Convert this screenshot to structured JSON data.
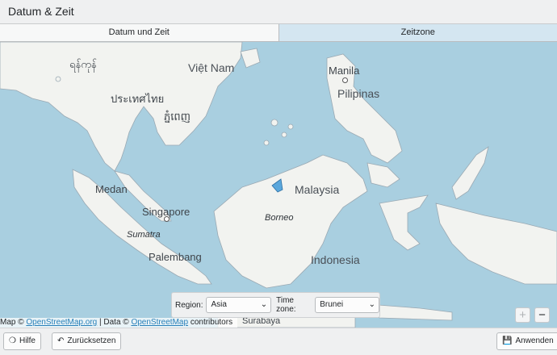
{
  "window": {
    "title": "Datum & Zeit"
  },
  "tabs": [
    {
      "label": "Datum und Zeit",
      "active": false
    },
    {
      "label": "Zeitzone",
      "active": true
    }
  ],
  "map": {
    "labels": {
      "myanmar": "ရန်ကုန်",
      "vietnam": "Việt Nam",
      "thailand": "ประเทศไทย",
      "cambodia": "ភ្នំពេញ",
      "manila": "Manila",
      "pilipinas": "Pilipinas",
      "medan": "Medan",
      "malaysia": "Malaysia",
      "singapore": "Singapore",
      "borneo": "Borneo",
      "sumatra": "Sumatra",
      "palembang": "Palembang",
      "indonesia": "Indonesia",
      "surabaya": "Surabaya"
    },
    "attribution": {
      "prefix": "Map ©",
      "osm_org": "OpenStreetMap.org",
      "middle": "| Data ©",
      "osm": "OpenStreetMap",
      "suffix": "contributors"
    },
    "zoom_in": "+",
    "zoom_out": "−",
    "colors": {
      "water": "#a9cfe0",
      "land": "#f2f3f0",
      "highlight": "#5aa7dc"
    }
  },
  "timezone_selector": {
    "region_label": "Region:",
    "region_value": "Asia",
    "timezone_label": "Time zone:",
    "timezone_value": "Brunei"
  },
  "buttons": {
    "help": "Hilfe",
    "reset": "Zurücksetzen",
    "apply": "Anwenden"
  }
}
